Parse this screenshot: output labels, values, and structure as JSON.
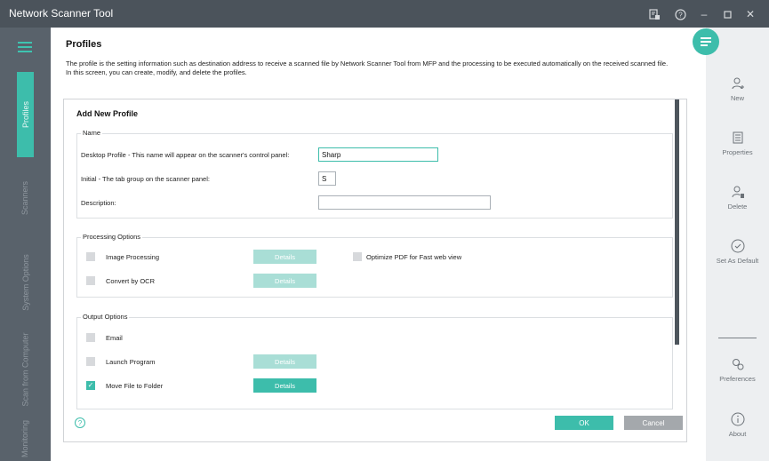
{
  "app": {
    "title": "Network Scanner Tool"
  },
  "leftnav": {
    "items": [
      {
        "label": "Profiles",
        "active": true
      },
      {
        "label": "Scanners",
        "active": false
      },
      {
        "label": "System Options",
        "active": false
      },
      {
        "label": "Scan from Computer",
        "active": false
      },
      {
        "label": "Monitoring",
        "active": false
      }
    ]
  },
  "page": {
    "title": "Profiles",
    "description": "The profile is the setting information such as destination address to receive a scanned file by Network Scanner Tool from MFP and the processing to be executed automatically on the received scanned file.",
    "description2": "In this screen, you can create, modify, and delete the profiles."
  },
  "form": {
    "title": "Add New Profile",
    "name_group": {
      "legend": "Name",
      "desktop_label": "Desktop Profile - This name will appear on the scanner's control panel:",
      "desktop_value": "Sharp",
      "initial_label": "Initial - The tab group on the scanner panel:",
      "initial_value": "S",
      "description_label": "Description:",
      "description_value": ""
    },
    "processing_group": {
      "legend": "Processing Options",
      "image_processing": "Image Processing",
      "convert_ocr": "Convert by OCR",
      "optimize_pdf": "Optimize PDF for Fast web view",
      "details": "Details"
    },
    "output_group": {
      "legend": "Output Options",
      "email": "Email",
      "launch_program": "Launch Program",
      "move_file": "Move File to Folder",
      "details": "Details"
    },
    "ok": "OK",
    "cancel": "Cancel"
  },
  "rightpanel": {
    "new": "New",
    "properties": "Properties",
    "delete": "Delete",
    "set_default": "Set As Default",
    "preferences": "Preferences",
    "about": "About"
  },
  "colors": {
    "accent": "#3dbdab",
    "titlebar": "#4b535b",
    "nav": "#59626b"
  }
}
